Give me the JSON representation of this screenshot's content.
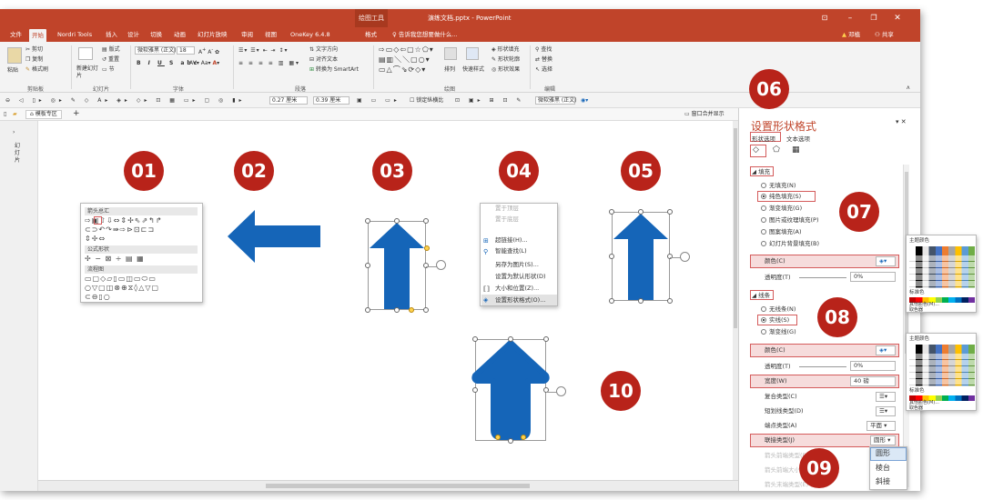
{
  "window": {
    "context_tools": "绘图工具",
    "doc_title": "演练文档.pptx - PowerPoint",
    "controls": {
      "ribbon_options": "⊡",
      "minimize": "–",
      "restore": "❐",
      "close": "✕"
    },
    "tell_me": "告诉我您想要做什么...",
    "user": "邓植",
    "share": "共享"
  },
  "tabs": [
    "文件",
    "开始",
    "Nordri Tools",
    "插入",
    "设计",
    "切换",
    "动画",
    "幻灯片放映",
    "审阅",
    "视图",
    "OneKey 6.4.8",
    "格式"
  ],
  "ribbon": {
    "clipboard": {
      "paste": "粘贴",
      "cut": "剪切",
      "copy": "复制",
      "format_painter": "格式刷",
      "label": "剪贴板"
    },
    "slides": {
      "new_slide": "新建幻灯片",
      "layout": "版式",
      "reset": "重置",
      "section": "节",
      "label": "幻灯片"
    },
    "font": {
      "name": "微软雅黑 (正文)",
      "size": "18",
      "label": "字体"
    },
    "paragraph": {
      "text_direction": "文字方向",
      "align_text": "对齐文本",
      "smartart": "转换为 SmartArt",
      "label": "段落"
    },
    "drawing": {
      "arrange": "排列",
      "quick_styles": "快速样式",
      "shape_fill": "形状填充",
      "shape_outline": "形状轮廓",
      "shape_effects": "形状效果",
      "label": "绘图"
    },
    "editing": {
      "find": "查找",
      "replace": "替换",
      "select": "选择",
      "label": "编辑"
    }
  },
  "toolbar2": {
    "height": "0.27 厘米",
    "width": "0.39 厘米",
    "lock_ratio": "锁定纵横比",
    "font": "微软雅黑 (正文)"
  },
  "doc_tabs": {
    "template_zone": "模板专区",
    "add": "+",
    "merge_windows": "窗口合并显示"
  },
  "left_panel": {
    "label": "幻灯片"
  },
  "badges": [
    "01",
    "02",
    "03",
    "04",
    "05",
    "06",
    "07",
    "08",
    "09",
    "10"
  ],
  "shape_gallery": {
    "arrows_header": "箭头总汇",
    "equation_header": "公式形状",
    "flowchart_header": "流程图"
  },
  "context_menu": [
    "置于顶层",
    "置于底层",
    "超链接(H)...",
    "智能查找(L)",
    "另存为图片(S)...",
    "设置为默认形状(D)",
    "大小和位置(Z)...",
    "设置形状格式(O)..."
  ],
  "format_panel": {
    "title": "设置形状格式",
    "tab_shape": "形状选项",
    "tab_text": "文本选项",
    "fill": {
      "header": "填充",
      "options": [
        "无填充(N)",
        "纯色填充(S)",
        "渐变填充(G)",
        "图片或纹理填充(P)",
        "图案填充(A)",
        "幻灯片背景填充(B)"
      ],
      "color_label": "颜色(C)",
      "transparency_label": "透明度(T)",
      "transparency_value": "0%"
    },
    "line": {
      "header": "线条",
      "options": [
        "无线条(N)",
        "实线(S)",
        "渐变线(G)"
      ],
      "color_label": "颜色(C)",
      "transparency_label": "透明度(T)",
      "transparency_value": "0%",
      "width_label": "宽度(W)",
      "width_value": "40 磅",
      "compound_label": "复合类型(C)",
      "dash_label": "短划线类型(D)",
      "cap_label": "端点类型(A)",
      "cap_value": "平面",
      "join_label": "联接类型(J)",
      "join_value": "圆形",
      "begin_arrow_label": "箭头前端类型(B)",
      "begin_arrow_size_label": "箭头前端大小(S)",
      "end_arrow_label": "箭头末端类型(E)"
    }
  },
  "join_dropdown": [
    "圆形",
    "棱台",
    "斜接"
  ],
  "color_picker": {
    "theme_colors": "主题颜色",
    "standard_colors": "标准色",
    "more_colors": "其他颜色(M)...",
    "eyedropper": "取色器"
  },
  "colors": {
    "accent": "#c0442a",
    "badge": "#b8231a",
    "arrow": "#1565b8",
    "highlight": "#d45b5b"
  }
}
